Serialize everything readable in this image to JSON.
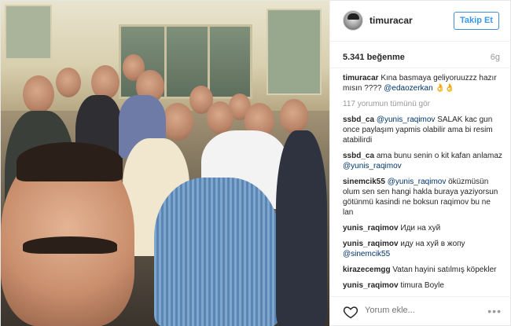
{
  "post": {
    "username": "timuracar",
    "follow_label": "Takip Et",
    "likes": "5.341 beğenme",
    "age": "6g",
    "caption": {
      "author": "timuracar",
      "text": "Kına basmaya geliyoruuzzz hazır mısın ????",
      "mention": "@edaozerkan",
      "emoji": "👌👌"
    },
    "view_all": "117 yorumun tümünü gör",
    "comments": [
      {
        "author": "ssbd_ca",
        "mention": "@yunis_raqimov",
        "text": "SALAK kac gun once paylaşım yapmis olabilir ama bi resim atabilirdi"
      },
      {
        "author": "ssbd_ca",
        "mention": "",
        "text": "ama bunu senin o kit kafan anlamaz",
        "trailing_mention": "@yunis_raqimov"
      },
      {
        "author": "sinemcik55",
        "mention": "@yunis_raqimov",
        "text": "öküzmüsün olum sen sen hangi hakla buraya yaziyorsun götünmü kasindi ne boksun raqimov bu ne lan"
      },
      {
        "author": "yunis_raqimov",
        "mention": "",
        "text": "Иди на хуй"
      },
      {
        "author": "yunis_raqimov",
        "mention": "",
        "text": "иду на хуй в жопу",
        "trailing_mention": "@sinemcik55"
      },
      {
        "author": "kirazecemgg",
        "mention": "",
        "text": "Vatan hayini satılmış köpekler"
      },
      {
        "author": "yunis_raqimov",
        "mention": "",
        "text": "timura Boyle"
      }
    ],
    "comment_placeholder": "Yorum ekle...",
    "more_label": "•••"
  },
  "icons": {
    "heart": "heart-icon",
    "avatar": "avatar",
    "more": "more-options-icon"
  },
  "colors": {
    "follow_blue": "#3897f0",
    "mention_blue": "#003569",
    "muted": "#999999",
    "text": "#262626",
    "border": "#efefef"
  }
}
